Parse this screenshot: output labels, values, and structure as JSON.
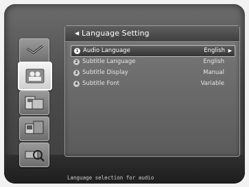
{
  "panel": {
    "title": "Language Setting",
    "title_arrow": "◀",
    "rows": [
      {
        "num": "1",
        "label": "Audio Language",
        "value": "English",
        "chevron": "▶"
      },
      {
        "num": "2",
        "label": "Subtitle Language",
        "value": "English"
      },
      {
        "num": "3",
        "label": "Subtitle Display",
        "value": "Manual"
      },
      {
        "num": "4",
        "label": "Subtitle Font",
        "value": "Variable"
      }
    ]
  },
  "sidebar": {
    "items": [
      {
        "icon": "satellite-dish-icon"
      },
      {
        "icon": "user-settings-icon",
        "active": true
      },
      {
        "icon": "folder-media-icon"
      },
      {
        "icon": "tv-setup-icon"
      },
      {
        "icon": "info-search-icon"
      }
    ]
  },
  "status_bar": {
    "text": "Language selection for audio"
  }
}
